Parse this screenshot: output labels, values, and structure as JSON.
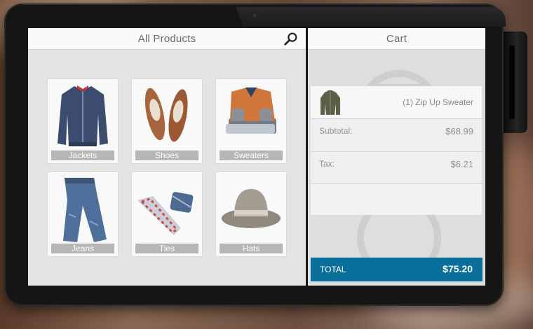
{
  "products": {
    "title": "All Products",
    "categories": [
      {
        "label": "Jackets"
      },
      {
        "label": "Shoes"
      },
      {
        "label": "Sweaters"
      },
      {
        "label": "Jeans"
      },
      {
        "label": "Ties"
      },
      {
        "label": "Hats"
      }
    ]
  },
  "cart": {
    "title": "Cart",
    "items": [
      {
        "name": "(1) Zip Up Sweater"
      }
    ],
    "subtotal_label": "Subtotal:",
    "subtotal_value": "$68.99",
    "tax_label": "Tax:",
    "tax_value": "$6.21",
    "total_label": "TOTAL",
    "total_value": "$75.20"
  },
  "colors": {
    "accent": "#0a6f9a",
    "tile_label_bg": "#b6b6b6"
  },
  "icons": {
    "search": "search-icon"
  }
}
